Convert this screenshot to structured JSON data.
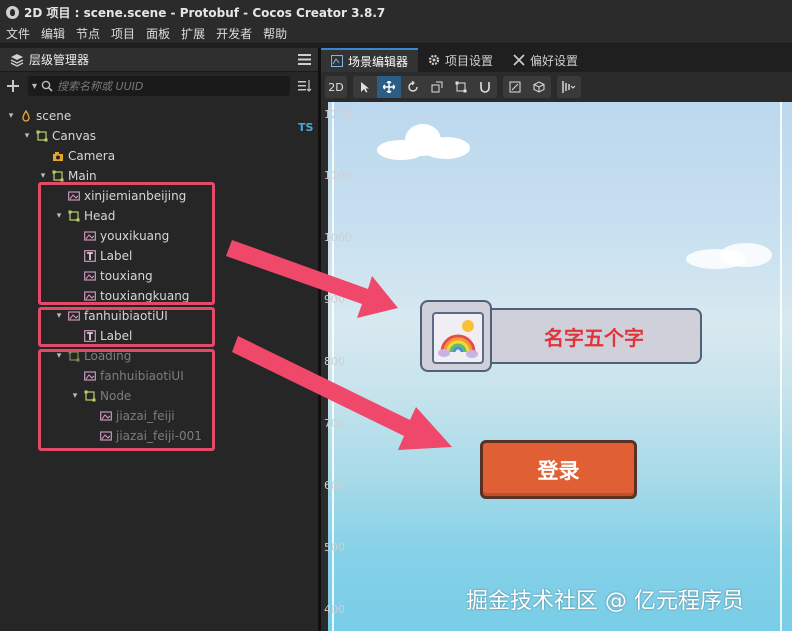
{
  "window": {
    "title": "2D 项目 : scene.scene - Protobuf - Cocos Creator 3.8.7"
  },
  "menu": [
    "文件",
    "编辑",
    "节点",
    "项目",
    "面板",
    "扩展",
    "开发者",
    "帮助"
  ],
  "hierarchy": {
    "title": "层级管理器",
    "search_placeholder": "搜索名称或 UUID",
    "ts_badge": "TS",
    "nodes": [
      {
        "label": "scene",
        "icon": "scene-icon",
        "expanded": true
      },
      {
        "label": "Canvas",
        "icon": "node-icon",
        "expanded": true
      },
      {
        "label": "Camera",
        "icon": "camera-icon"
      },
      {
        "label": "Main",
        "icon": "node-icon",
        "expanded": true
      },
      {
        "label": "xinjiemianbeijing",
        "icon": "sprite-icon"
      },
      {
        "label": "Head",
        "icon": "node-icon",
        "expanded": true
      },
      {
        "label": "youxikuang",
        "icon": "sprite-icon"
      },
      {
        "label": "Label",
        "icon": "label-icon"
      },
      {
        "label": "touxiang",
        "icon": "sprite-icon"
      },
      {
        "label": "touxiangkuang",
        "icon": "sprite-icon"
      },
      {
        "label": "fanhuibiaotiUI",
        "icon": "sprite-icon",
        "expanded": true
      },
      {
        "label": "Label",
        "icon": "label-icon"
      },
      {
        "label": "Loading",
        "icon": "node-icon",
        "expanded": true,
        "inactive": true
      },
      {
        "label": "fanhuibiaotiUI",
        "icon": "sprite-icon",
        "inactive": true
      },
      {
        "label": "Node",
        "icon": "node-icon",
        "expanded": true,
        "inactive": true
      },
      {
        "label": "jiazai_feiji",
        "icon": "sprite-icon",
        "inactive": true
      },
      {
        "label": "jiazai_feiji-001",
        "icon": "sprite-icon",
        "inactive": true
      }
    ]
  },
  "editor": {
    "tabs": [
      "场景编辑器",
      "项目设置",
      "偏好设置"
    ],
    "mode_2d": "2D",
    "ruler": [
      "1200",
      "1100",
      "1000",
      "900",
      "800",
      "700",
      "600",
      "500",
      "400"
    ],
    "card_name": "名字五个字",
    "login_label": "登录"
  },
  "watermark": "掘金技术社区 @ 亿元程序员",
  "colors": {
    "highlight_box": "#e34a6a",
    "arrow": "#f0486a",
    "accent_tab": "#3a86d1",
    "login_button": "#e05f34",
    "card_name_text": "#e3333a"
  }
}
